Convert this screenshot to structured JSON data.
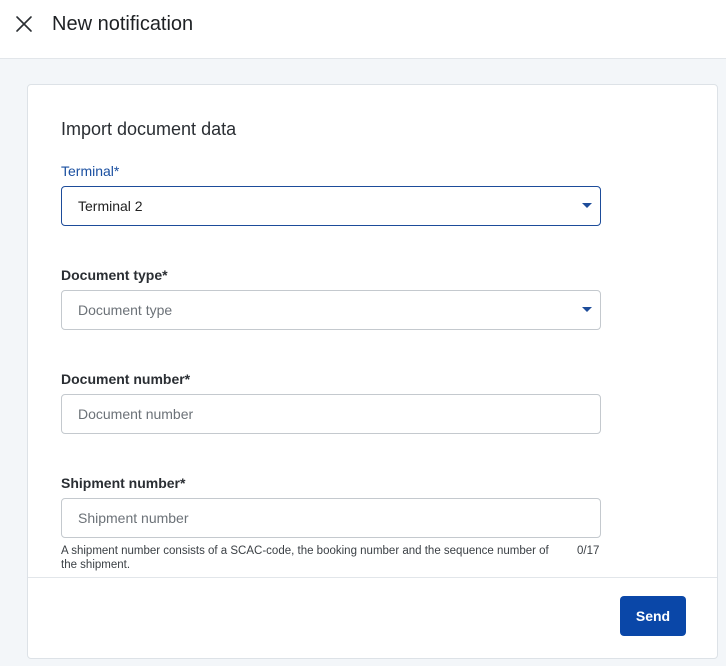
{
  "header": {
    "title": "New notification",
    "close_icon": "close-icon"
  },
  "form": {
    "section_title": "Import document data",
    "terminal": {
      "label": "Terminal*",
      "value": "Terminal 2"
    },
    "document_type": {
      "label": "Document type*",
      "placeholder": "Document type"
    },
    "document_number": {
      "label": "Document number*",
      "placeholder": "Document number"
    },
    "shipment_number": {
      "label": "Shipment number*",
      "placeholder": "Shipment number",
      "helper": "A shipment number consists of a SCAC-code, the booking number and the sequence number of the shipment.",
      "counter": "0/17"
    }
  },
  "footer": {
    "send_label": "Send"
  },
  "colors": {
    "accent": "#0a47a8",
    "focus_border": "#1d4c9a"
  }
}
